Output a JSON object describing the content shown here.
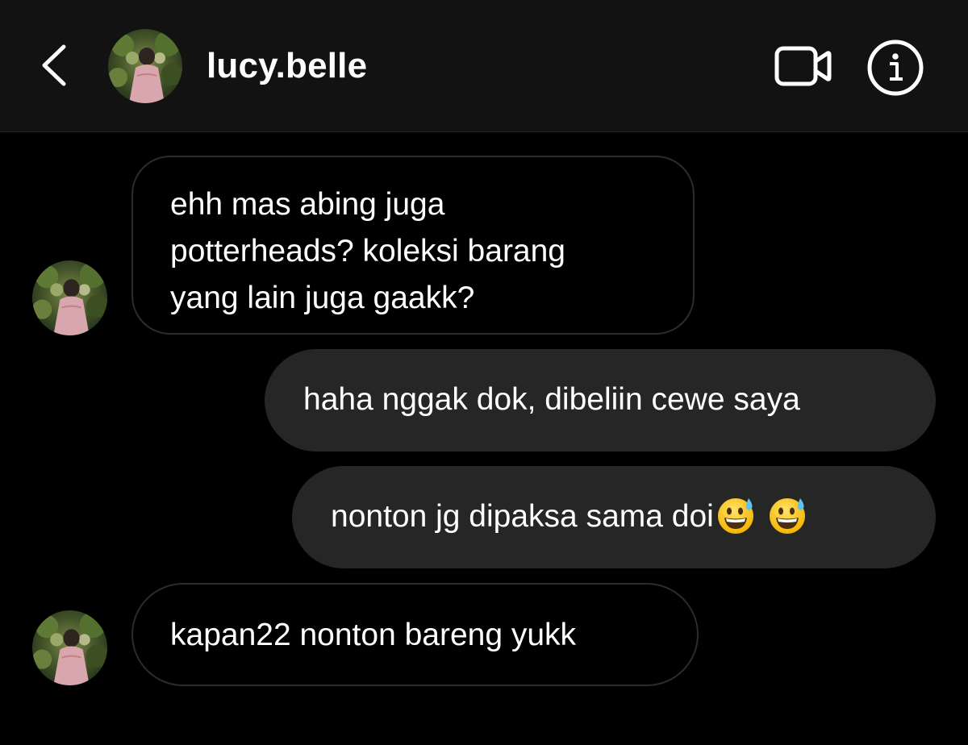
{
  "header": {
    "username": "lucy.belle",
    "back_icon": "chevron-left-icon",
    "video_icon": "video-camera-icon",
    "info_icon": "info-icon"
  },
  "messages": [
    {
      "direction": "incoming",
      "lines": [
        "ehh mas abing juga",
        "potterheads? koleksi barang",
        "yang lain juga gaakk?"
      ]
    },
    {
      "direction": "outgoing",
      "text": "haha nggak dok, dibeliin cewe saya"
    },
    {
      "direction": "outgoing",
      "text": "nonton jg dipaksa sama doi",
      "emoji": [
        "😅",
        "😅"
      ]
    },
    {
      "direction": "incoming",
      "text": "kapan22 nonton bareng yukk"
    }
  ],
  "colors": {
    "background": "#000000",
    "header": "#121212",
    "outgoing_bubble": "#262626",
    "incoming_border": "#2c2c2c",
    "text": "#ffffff"
  }
}
